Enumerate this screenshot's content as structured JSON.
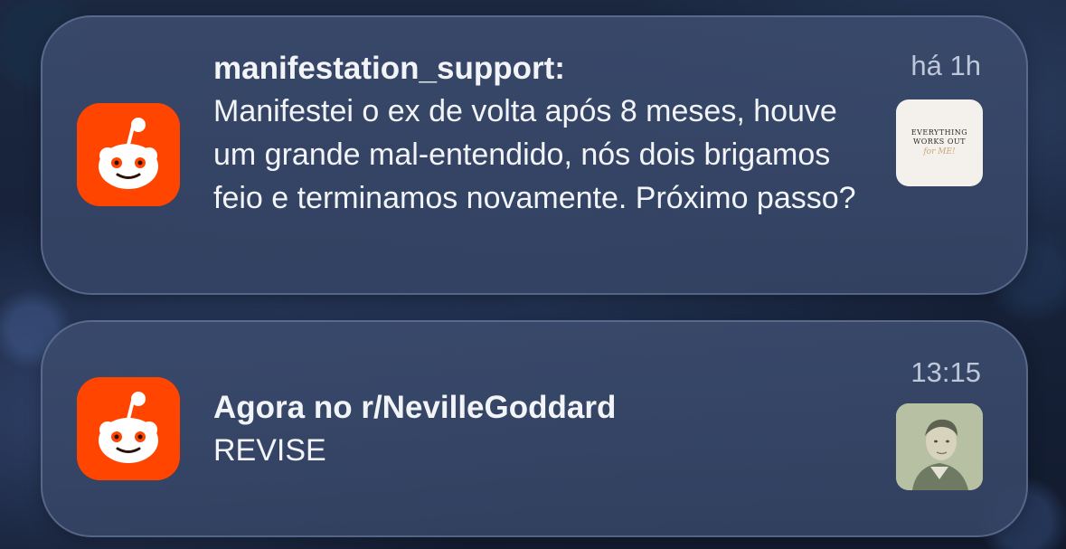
{
  "notifications": [
    {
      "app_icon": "reddit-snoo-icon",
      "title": "manifestation_support:",
      "body": "Manifestei o ex de volta após 8 meses, houve um grande mal-entendido, nós dois brigamos feio e terminamos novamente. Próximo passo?",
      "time": "há 1h",
      "thumbnail": {
        "line1": "EVERYTHING",
        "line2": "WORKS OUT",
        "script": "for ME!"
      }
    },
    {
      "app_icon": "reddit-snoo-icon",
      "title": "Agora no r/NevilleGoddard",
      "body": "REVISE",
      "time": "13:15",
      "thumbnail": {
        "image": "vintage-portrait-photo"
      }
    }
  ],
  "colors": {
    "reddit_orange": "#ff4500",
    "card_background": "#3a4a6c",
    "text_primary": "#f2f4f8"
  }
}
